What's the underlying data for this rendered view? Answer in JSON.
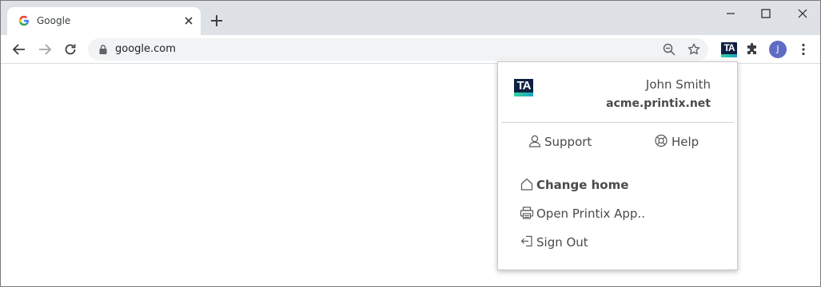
{
  "tab": {
    "title": "Google"
  },
  "omnibox": {
    "url": "google.com"
  },
  "extension": {
    "logo_text": "TA"
  },
  "profile": {
    "initial": "J"
  },
  "popup": {
    "logo_text": "TA",
    "user_name": "John Smith",
    "tenant": "acme.printix.net",
    "support_label": "Support",
    "help_label": "Help",
    "change_home_label": "Change home",
    "open_app_label": "Open Printix App..",
    "sign_out_label": "Sign Out"
  }
}
